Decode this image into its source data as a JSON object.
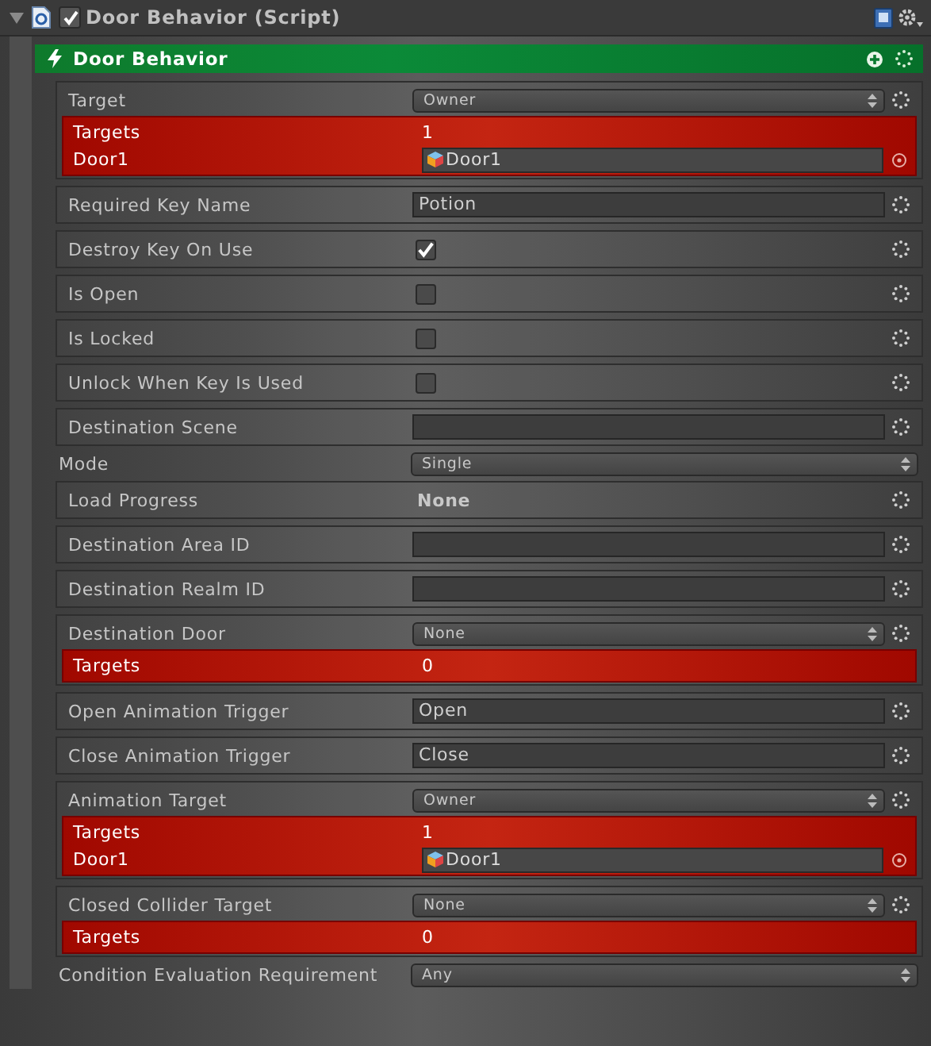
{
  "component": {
    "title": "Door Behavior (Script)",
    "enabled": true,
    "expanded": true
  },
  "panel": {
    "title": "Door Behavior"
  },
  "properties": [
    {
      "kind": "popup",
      "label": "Target",
      "value": "Owner",
      "targets": {
        "label": "Targets",
        "count": "1",
        "objects": [
          {
            "label": "Door1",
            "value": "Door1"
          }
        ]
      }
    },
    {
      "kind": "text",
      "label": "Required Key Name",
      "value": "Potion"
    },
    {
      "kind": "toggle",
      "label": "Destroy Key On Use",
      "checked": true
    },
    {
      "kind": "toggle",
      "label": "Is Open",
      "checked": false
    },
    {
      "kind": "toggle",
      "label": "Is Locked",
      "checked": false
    },
    {
      "kind": "toggle",
      "label": "Unlock When Key Is Used",
      "checked": false
    },
    {
      "kind": "text",
      "label": "Destination Scene"
    },
    {
      "kind": "bare_popup",
      "label": "Mode",
      "value": "Single"
    },
    {
      "kind": "readout",
      "label": "Load Progress",
      "value": "None"
    },
    {
      "kind": "text",
      "label": "Destination Area ID"
    },
    {
      "kind": "text",
      "label": "Destination Realm ID"
    },
    {
      "kind": "popup",
      "label": "Destination Door",
      "value": "None",
      "targets": {
        "label": "Targets",
        "count": "0"
      }
    },
    {
      "kind": "text",
      "label": "Open Animation Trigger",
      "value": "Open"
    },
    {
      "kind": "text",
      "label": "Close Animation Trigger",
      "value": "Close"
    },
    {
      "kind": "popup",
      "label": "Animation Target",
      "value": "Owner",
      "targets": {
        "label": "Targets",
        "count": "1",
        "objects": [
          {
            "label": "Door1",
            "value": "Door1"
          }
        ]
      }
    },
    {
      "kind": "popup",
      "label": "Closed Collider Target",
      "value": "None",
      "targets": {
        "label": "Targets",
        "count": "0"
      }
    },
    {
      "kind": "bare_popup",
      "label": "Condition Evaluation Requirement",
      "value": "Any"
    }
  ]
}
